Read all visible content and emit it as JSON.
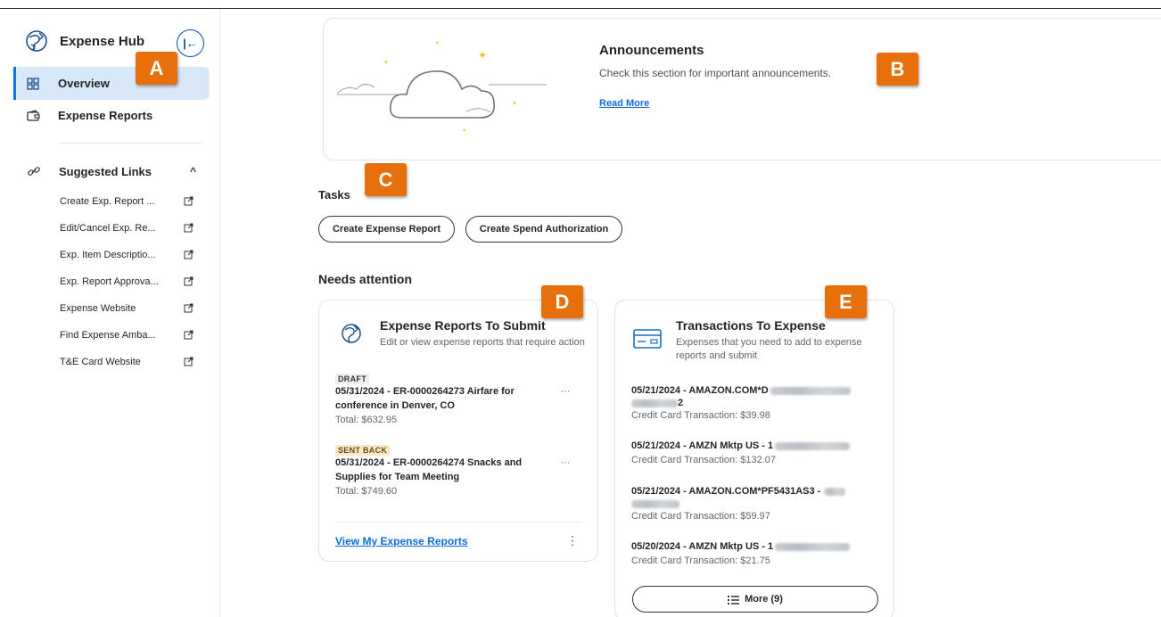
{
  "sidebar": {
    "title": "Expense Hub",
    "collapse_glyph": "|←",
    "nav": [
      {
        "label": "Overview",
        "icon": "grid-icon",
        "active": true
      },
      {
        "label": "Expense Reports",
        "icon": "wallet-icon",
        "active": false
      }
    ],
    "suggested": {
      "label": "Suggested Links",
      "links": [
        "Create Exp. Report ...",
        "Edit/Cancel Exp. Re...",
        "Exp. Item Descriptio...",
        "Exp. Report Approva...",
        "Expense Website",
        "Find Expense Amba...",
        "T&E Card Website"
      ]
    }
  },
  "badges": {
    "a": "A",
    "b": "B",
    "c": "C",
    "d": "D",
    "e": "E"
  },
  "announcements": {
    "title": "Announcements",
    "text": "Check this section for important announcements.",
    "link": "Read More"
  },
  "tasks": {
    "title": "Tasks",
    "buttons": [
      "Create Expense Report",
      "Create Spend Authorization"
    ]
  },
  "needs_attention": {
    "title": "Needs attention",
    "reports_card": {
      "title": "Expense Reports To Submit",
      "subtitle": "Edit or view expense reports that require action",
      "items": [
        {
          "status": "DRAFT",
          "line1": "05/31/2024 - ER-0000264273 Airfare for",
          "line2": "conference in Denver, CO",
          "total": "Total: $632.95"
        },
        {
          "status": "SENT BACK",
          "line1": "05/31/2024 - ER-0000264274 Snacks and",
          "line2": "Supplies for Team Meeting",
          "total": "Total: $749.60"
        }
      ],
      "item_menu": "···",
      "footer_link": "View My Expense Reports",
      "footer_menu": "⋮"
    },
    "transactions_card": {
      "title": "Transactions To Expense",
      "subtitle_line1": "Expenses that you need to add to expense",
      "subtitle_line2": "reports and submit",
      "items": [
        {
          "title": "05/21/2024 - AMAZON.COM*D",
          "title_cont": "2",
          "sub": "Credit Card Transaction: $39.98"
        },
        {
          "title": "05/21/2024 - AMZN Mktp US - 1",
          "sub": "Credit Card Transaction: $132.07"
        },
        {
          "title": "05/21/2024 - AMAZON.COM*PF5431AS3 -",
          "sub": "Credit Card Transaction: $59.97"
        },
        {
          "title": "05/20/2024 - AMZN Mktp US - 1",
          "sub": "Credit Card Transaction: $21.75"
        }
      ],
      "more_button": "More (9)"
    }
  },
  "colors": {
    "accent": "#0875e1",
    "badge": "#e8700c",
    "link": "#0b6ed6",
    "active_bg": "#d9e8f9"
  }
}
